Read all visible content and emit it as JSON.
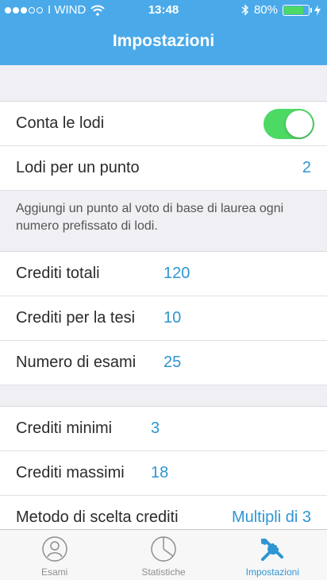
{
  "status_bar": {
    "carrier": "I WIND",
    "time": "13:48",
    "battery_percent": "80%",
    "battery_level": 0.8
  },
  "header": {
    "title": "Impostazioni"
  },
  "lodi_section": {
    "conta_le_lodi": {
      "label": "Conta le lodi",
      "toggle_on": true
    },
    "lodi_per_un_punto": {
      "label": "Lodi per un punto",
      "value": "2"
    },
    "footnote": "Aggiungi un punto al voto di base di laurea ogni numero prefissato di lodi."
  },
  "crediti_section": {
    "rows": [
      {
        "label": "Crediti totali",
        "value": "120"
      },
      {
        "label": "Crediti per la tesi",
        "value": "10"
      },
      {
        "label": "Numero di esami",
        "value": "25"
      }
    ]
  },
  "limits_section": {
    "rows": [
      {
        "label": "Crediti minimi",
        "value": "3"
      },
      {
        "label": "Crediti massimi",
        "value": "18"
      },
      {
        "label": "Metodo di scelta crediti",
        "value": "Multipli di 3"
      }
    ]
  },
  "tabbar": {
    "tabs": [
      {
        "label": "Esami",
        "icon": "person-icon",
        "active": false
      },
      {
        "label": "Statistiche",
        "icon": "pie-chart-icon",
        "active": false
      },
      {
        "label": "Impostazioni",
        "icon": "tools-icon",
        "active": true
      }
    ]
  },
  "colors": {
    "header": "#4aaae9",
    "accent": "#2e95d3",
    "toggle_on": "#4cd964",
    "background": "#efeff4"
  }
}
